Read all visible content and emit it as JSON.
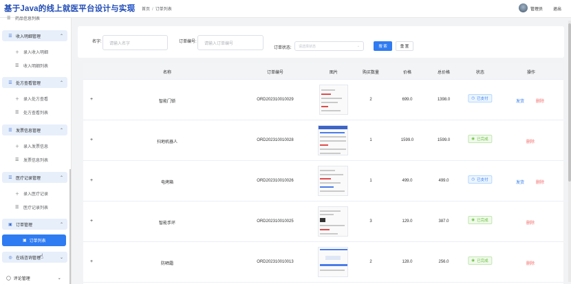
{
  "header": {
    "title": "基于Java的线上就医平台设计与实现",
    "breadcrumb": [
      "首页",
      "订单列表"
    ],
    "user": "管理员",
    "logout": "退出"
  },
  "sidebar": {
    "partial_top_item": "药品信息列表",
    "groups": [
      {
        "label": "收入明细管理",
        "items": [
          "录入收入明细",
          "收入明细列表"
        ]
      },
      {
        "label": "处方查看管理",
        "items": [
          "录入处方查看",
          "处方查看列表"
        ]
      },
      {
        "label": "发票信息管理",
        "items": [
          "录入发票信息",
          "发票信息列表"
        ]
      },
      {
        "label": "医疗记录管理",
        "items": [
          "录入医疗记录",
          "医疗记录列表"
        ]
      },
      {
        "label": "订单管理",
        "items": []
      },
      {
        "label": "在线咨询管理",
        "items": []
      }
    ],
    "active_item": "订单列表",
    "bottom_item": "评论管理"
  },
  "search": {
    "name_label": "名字:",
    "name_placeholder": "请输入名字",
    "order_no_label": "订单编号:",
    "order_no_placeholder": "请输入订单编号",
    "status_label": "订单状态:",
    "status_placeholder": "请选择状态",
    "search_button": "搜 索",
    "reset_button": "重 置"
  },
  "table": {
    "columns": [
      "名称",
      "订单编号",
      "图片",
      "购买数量",
      "价格",
      "总价格",
      "状态",
      "操作"
    ],
    "rows": [
      {
        "name": "智能门锁",
        "order_no": "ORD202310010029",
        "qty": "2",
        "price": "699.0",
        "total": "1398.0",
        "status": "已支付",
        "status_type": "paid",
        "ship": "发货",
        "delete": "删除"
      },
      {
        "name": "扫地机器人",
        "order_no": "ORD202310010028",
        "qty": "1",
        "price": "1599.0",
        "total": "1599.0",
        "status": "已完成",
        "status_type": "done",
        "ship": "",
        "delete": "删除"
      },
      {
        "name": "电烤箱",
        "order_no": "ORD202310010026",
        "qty": "1",
        "price": "499.0",
        "total": "499.0",
        "status": "已支付",
        "status_type": "paid",
        "ship": "发货",
        "delete": "删除"
      },
      {
        "name": "智能手环",
        "order_no": "ORD202310010025",
        "qty": "3",
        "price": "129.0",
        "total": "387.0",
        "status": "已完成",
        "status_type": "done",
        "ship": "",
        "delete": "删除"
      },
      {
        "name": "防晒霜",
        "order_no": "ORD202310010013",
        "qty": "2",
        "price": "128.0",
        "total": "256.0",
        "status": "已完成",
        "status_type": "done",
        "ship": "",
        "delete": "删除"
      }
    ]
  },
  "colors": {
    "primary": "#2f7bf1",
    "brand_title": "#1f4bb5",
    "danger": "#f56c6c",
    "success": "#67c23a"
  }
}
